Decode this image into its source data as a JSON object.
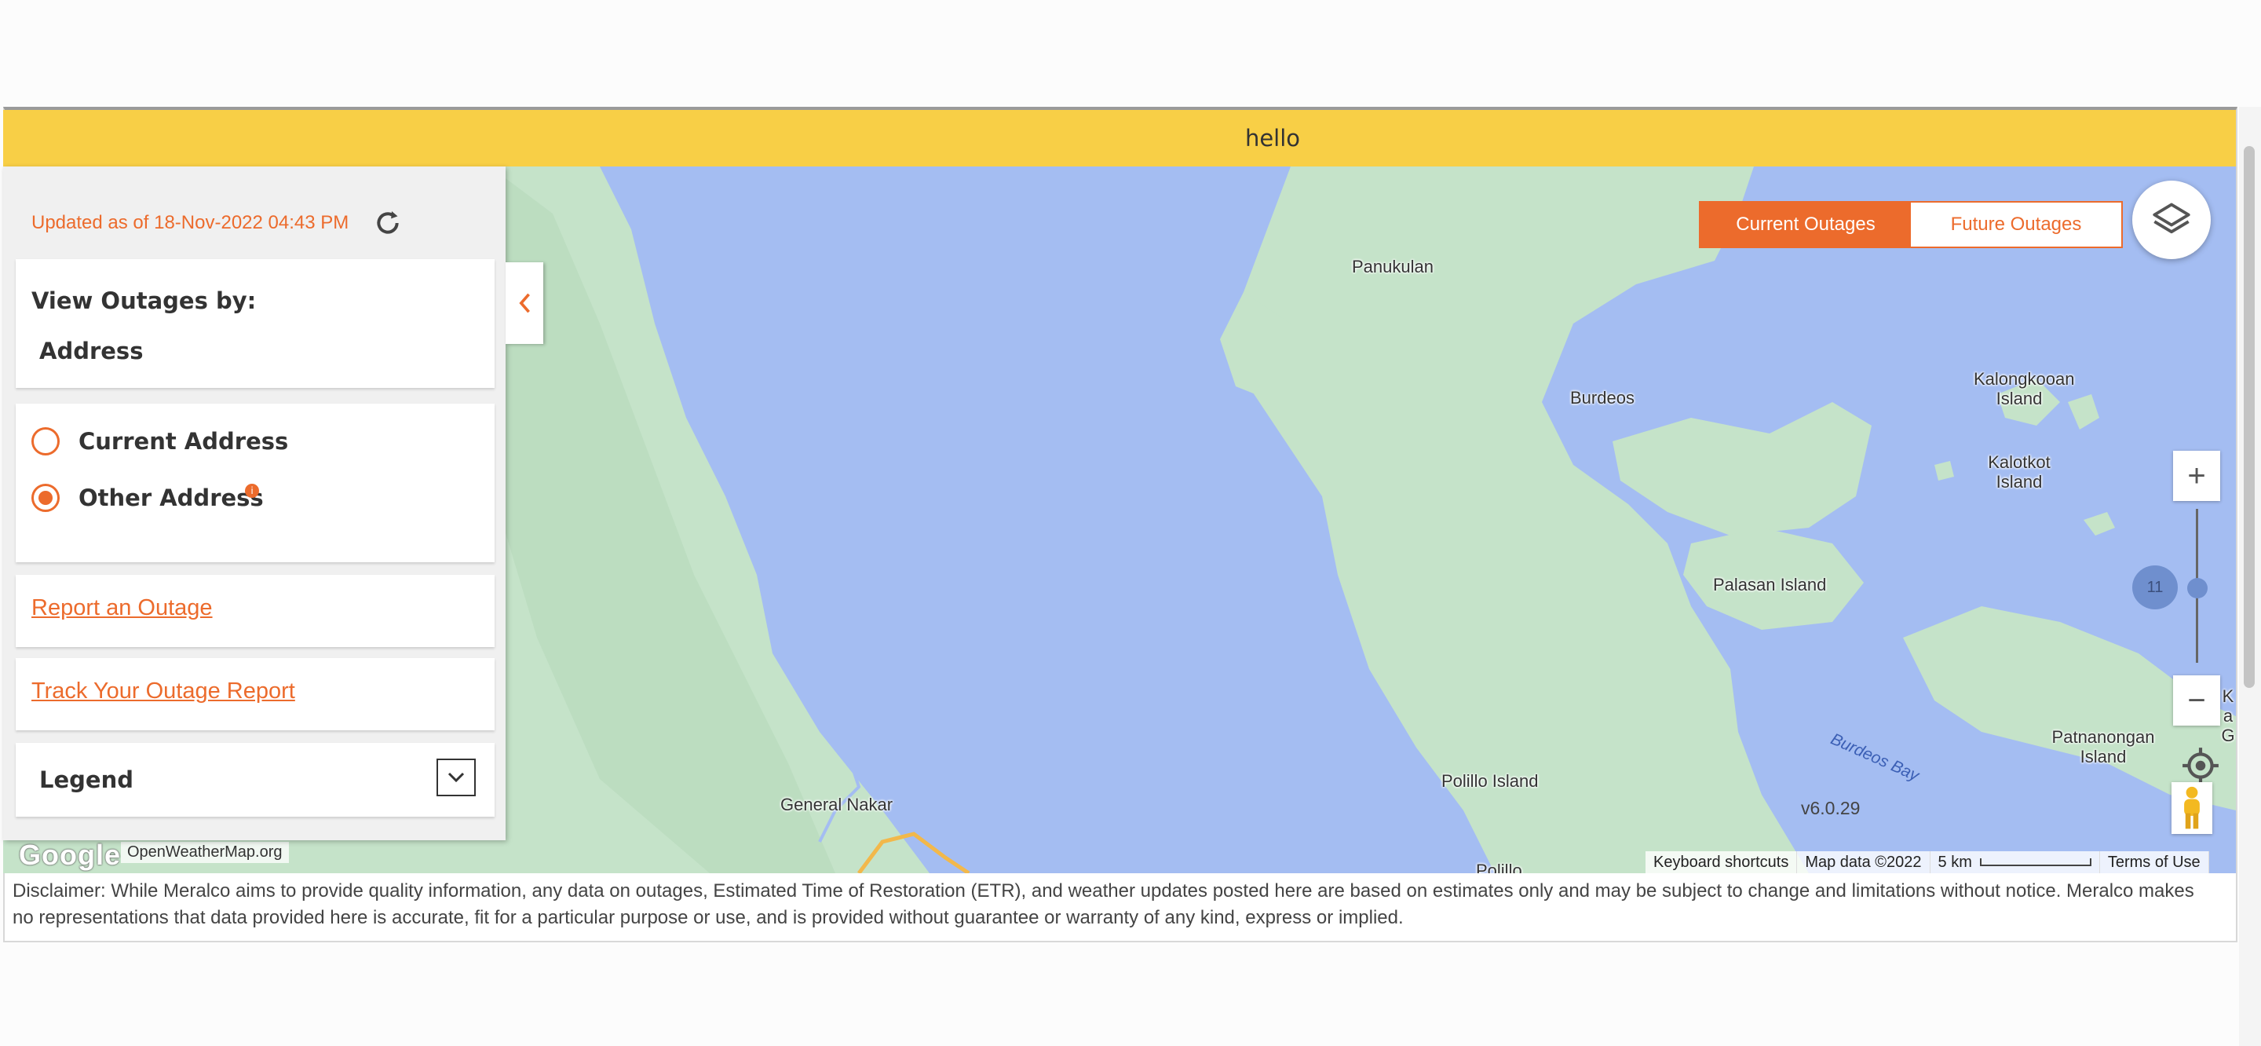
{
  "banner": {
    "text": "hello"
  },
  "panel": {
    "updated_text": "Updated as of 18-Nov-2022 04:43 PM",
    "view_by_title": "View Outages by:",
    "view_by_value": "Address",
    "options": [
      {
        "label": "Current Address",
        "selected": false
      },
      {
        "label": "Other Address",
        "selected": true
      }
    ],
    "report_link": "Report an Outage",
    "track_link": "Track Your Outage Report",
    "legend_label": "Legend"
  },
  "map": {
    "toggle": {
      "current": "Current Outages",
      "future": "Future Outages",
      "active": "current"
    },
    "zoom_level": "11",
    "version": "v6.0.29",
    "places": {
      "panukulan": "Panukulan",
      "burdeos": "Burdeos",
      "kalongkooan": "Kalongkooan Island",
      "kalotkot": "Kalotkot Island",
      "palasan": "Palasan Island",
      "polillo_island": "Polillo Island",
      "polillo": "Polillo",
      "general_nakar": "General Nakar",
      "patnanongan": "Patnanongan Island",
      "burdeos_bay": "Burdeos Bay",
      "edge_label": "Ka G"
    },
    "attribution": {
      "google": "Google",
      "owm": "OpenWeatherMap.org",
      "shortcuts": "Keyboard shortcuts",
      "map_data": "Map data ©2022",
      "scale": "5 km",
      "terms": "Terms of Use"
    }
  },
  "disclaimer": "Disclaimer: While Meralco aims to provide quality information, any data on outages, Estimated Time of Restoration (ETR), and weather updates posted here are based on estimates only and may be subject to change and limitations without notice. Meralco makes no representations that data provided here is accurate, fit for a particular purpose or use, and is provided without guarantee or warranty of any kind, express or implied.",
  "colors": {
    "accent": "#ec6b2c",
    "banner": "#f8cf46",
    "water": "#a4bdf2",
    "land": "#c5e3c9"
  }
}
